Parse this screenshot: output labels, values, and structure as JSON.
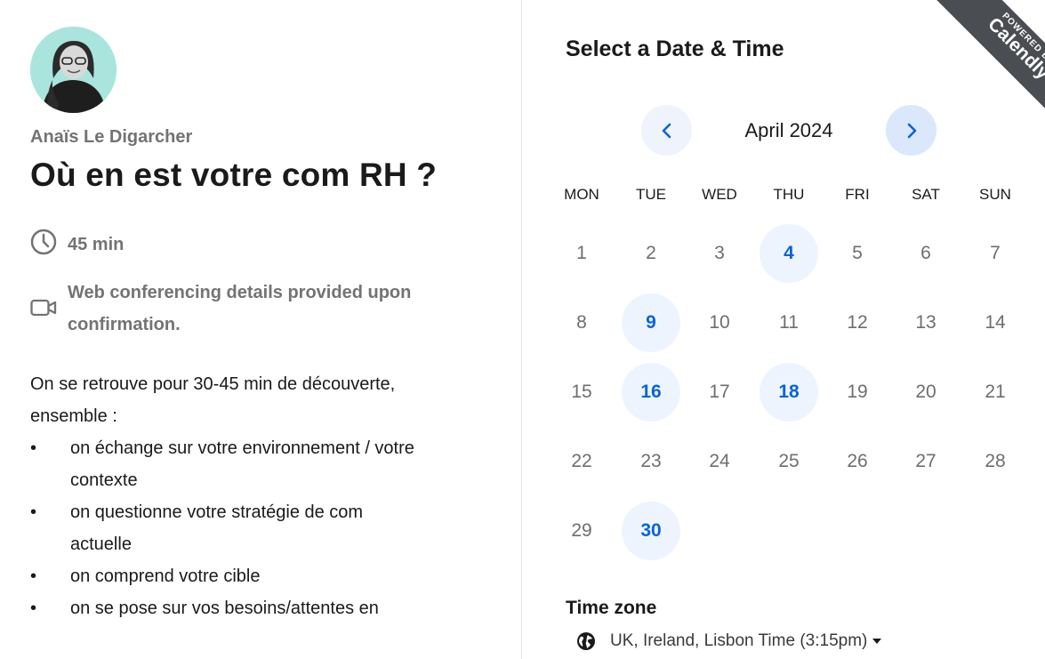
{
  "host": {
    "name": "Anaïs Le Digarcher"
  },
  "event": {
    "title": "Où en est votre com RH ?",
    "duration": "45 min",
    "conferencing_line1": "Web conferencing details provided upon",
    "conferencing_line2": "confirmation.",
    "description_intro_line1": "On se retrouve pour 30-45 min de découverte,",
    "description_intro_line2": "ensemble :",
    "bullets": [
      {
        "bullet": "•",
        "line1": "on échange sur votre environnement / votre",
        "line2": "contexte"
      },
      {
        "bullet": "•",
        "line1": "on questionne votre stratégie de com",
        "line2": "actuelle"
      },
      {
        "bullet": "•",
        "line1": "on comprend votre cible",
        "line2": ""
      },
      {
        "bullet": "•",
        "line1": "on se pose sur vos besoins/attentes en",
        "line2": ""
      }
    ]
  },
  "calendar": {
    "section_title": "Select a Date & Time",
    "month_label": "April 2024",
    "weekdays": [
      "MON",
      "TUE",
      "WED",
      "THU",
      "FRI",
      "SAT",
      "SUN"
    ],
    "first_weekday_index": 0,
    "days_in_month": 30,
    "available_days": [
      4,
      9,
      16,
      18,
      30
    ]
  },
  "timezone": {
    "label": "Time zone",
    "value": "UK, Ireland, Lisbon Time (3:15pm)"
  },
  "badge": {
    "powered_by": "POWERED BY",
    "brand": "Calendly"
  },
  "colors": {
    "accent": "#0a64d6",
    "available_bg": "#eef4fd",
    "badge_bg": "#4a4d52",
    "avatar_bg": "#a9e5dc"
  },
  "icons": {
    "prev": "chevron-left-icon",
    "next": "chevron-right-icon",
    "duration": "clock-icon",
    "conferencing": "video-camera-icon",
    "timezone": "globe-icon",
    "timezone_dropdown": "caret-down-icon"
  }
}
